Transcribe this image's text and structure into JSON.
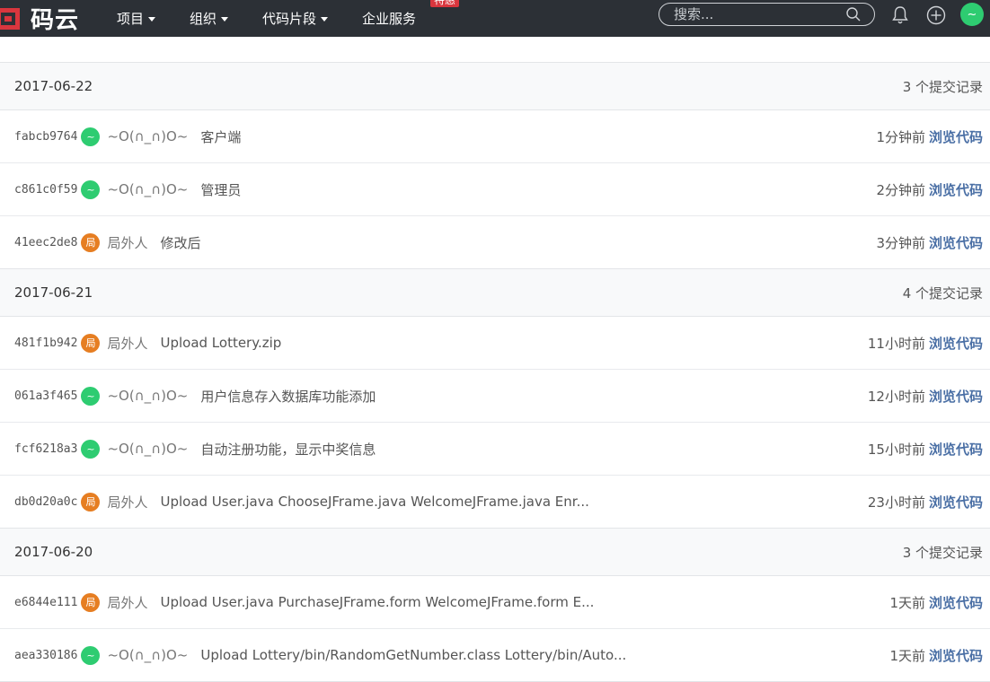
{
  "header": {
    "logo_text": "码云",
    "logo_color": "#d9363e",
    "nav": [
      {
        "label": "项目"
      },
      {
        "label": "组织"
      },
      {
        "label": "代码片段"
      },
      {
        "label": "企业服务",
        "badge": "特惠"
      }
    ],
    "search_placeholder": "搜索...",
    "user_avatar_text": "~",
    "icons": [
      "search-icon",
      "bell-icon",
      "plus-icon"
    ]
  },
  "colors": {
    "avatar_green": "#2ecc71",
    "avatar_orange": "#e67e22",
    "link_blue": "#4a6fa5"
  },
  "commit_groups": [
    {
      "date": "2017-06-22",
      "count": "3 个提交记录",
      "commits": [
        {
          "sha": "fabcb9764",
          "avatar_text": "~",
          "avatar_color": "green",
          "author": "~O(∩_∩)O~",
          "message": "客户端",
          "time": "1分钟前",
          "browse": "浏览代码"
        },
        {
          "sha": "c861c0f59",
          "avatar_text": "~",
          "avatar_color": "green",
          "author": "~O(∩_∩)O~",
          "message": "管理员",
          "time": "2分钟前",
          "browse": "浏览代码"
        },
        {
          "sha": "41eec2de8",
          "avatar_text": "局",
          "avatar_color": "orange",
          "author": "局外人",
          "message": "修改后",
          "time": "3分钟前",
          "browse": "浏览代码"
        }
      ]
    },
    {
      "date": "2017-06-21",
      "count": "4 个提交记录",
      "commits": [
        {
          "sha": "481f1b942",
          "avatar_text": "局",
          "avatar_color": "orange",
          "author": "局外人",
          "message": "Upload Lottery.zip",
          "time": "11小时前",
          "browse": "浏览代码"
        },
        {
          "sha": "061a3f465",
          "avatar_text": "~",
          "avatar_color": "green",
          "author": "~O(∩_∩)O~",
          "message": "用户信息存入数据库功能添加",
          "time": "12小时前",
          "browse": "浏览代码"
        },
        {
          "sha": "fcf6218a3",
          "avatar_text": "~",
          "avatar_color": "green",
          "author": "~O(∩_∩)O~",
          "message": "自动注册功能，显示中奖信息",
          "time": "15小时前",
          "browse": "浏览代码"
        },
        {
          "sha": "db0d20a0c",
          "avatar_text": "局",
          "avatar_color": "orange",
          "author": "局外人",
          "message": "Upload User.java ChooseJFrame.java WelcomeJFrame.java Enr...",
          "time": "23小时前",
          "browse": "浏览代码"
        }
      ]
    },
    {
      "date": "2017-06-20",
      "count": "3 个提交记录",
      "commits": [
        {
          "sha": "e6844e111",
          "avatar_text": "局",
          "avatar_color": "orange",
          "author": "局外人",
          "message": "Upload User.java PurchaseJFrame.form WelcomeJFrame.form E...",
          "time": "1天前",
          "browse": "浏览代码"
        },
        {
          "sha": "aea330186",
          "avatar_text": "~",
          "avatar_color": "green",
          "author": "~O(∩_∩)O~",
          "message": "Upload Lottery/bin/RandomGetNumber.class Lottery/bin/Auto...",
          "time": "1天前",
          "browse": "浏览代码"
        }
      ]
    }
  ]
}
